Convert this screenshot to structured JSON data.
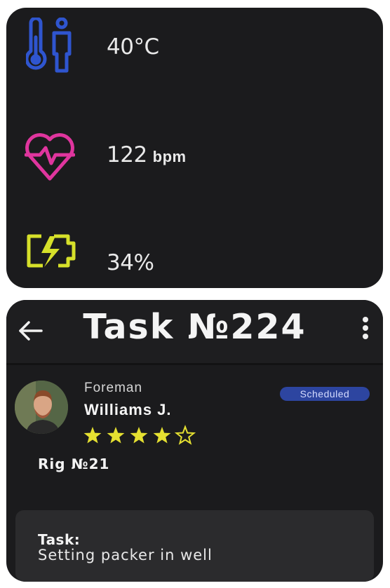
{
  "vitals": {
    "temperature": {
      "icon": "thermometer-person-icon",
      "value": "40°C",
      "color": "#2f55cf"
    },
    "heart_rate": {
      "icon": "heart-pulse-icon",
      "value": "122",
      "unit": "bpm",
      "color": "#e0359e"
    },
    "battery": {
      "icon": "battery-charging-icon",
      "value": "34%",
      "color": "#d6e02a"
    }
  },
  "header": {
    "title": "Task №224",
    "back_icon": "arrow-left-icon",
    "menu_icon": "more-vertical-icon"
  },
  "worker": {
    "role": "Foreman",
    "name": "Williams J.",
    "rating": 4,
    "rating_max": 5,
    "status": "Scheduled",
    "status_color": "#2d45a0",
    "star_color": "#e5e031"
  },
  "rig": "Rig №21",
  "task": {
    "label": "Task:",
    "description": "Setting packer in well"
  }
}
